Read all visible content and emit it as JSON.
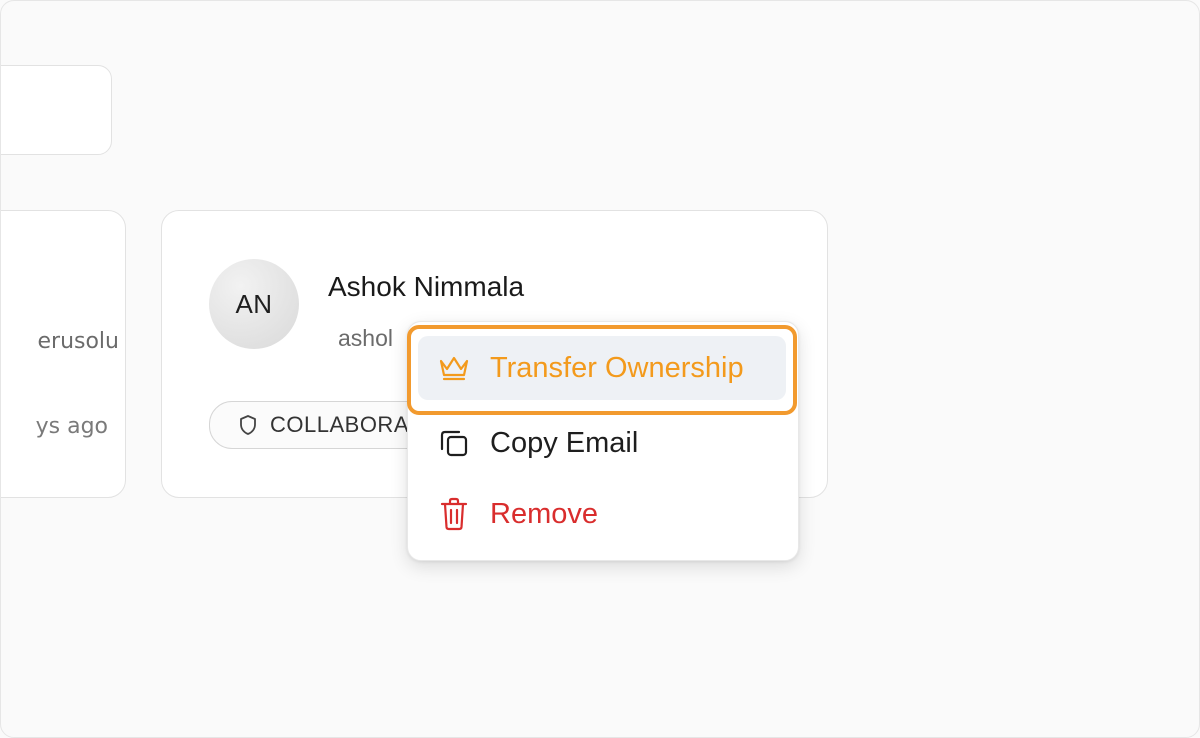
{
  "left_card": {
    "email_fragment": "erusolu",
    "time_fragment": "ys ago"
  },
  "member": {
    "initials": "AN",
    "name": "Ashok Nimmala",
    "email_fragment": "ashol",
    "role": "COLLABORATOR"
  },
  "menu": {
    "items": [
      {
        "label": "Transfer Ownership",
        "icon": "crown-icon"
      },
      {
        "label": "Copy Email",
        "icon": "copy-icon"
      },
      {
        "label": "Remove",
        "icon": "trash-icon"
      }
    ]
  },
  "colors": {
    "accent_orange": "#f39a1c",
    "danger_red": "#d92d2d",
    "highlight_border": "#f29a2e",
    "hover_bg": "#eef1f5"
  }
}
